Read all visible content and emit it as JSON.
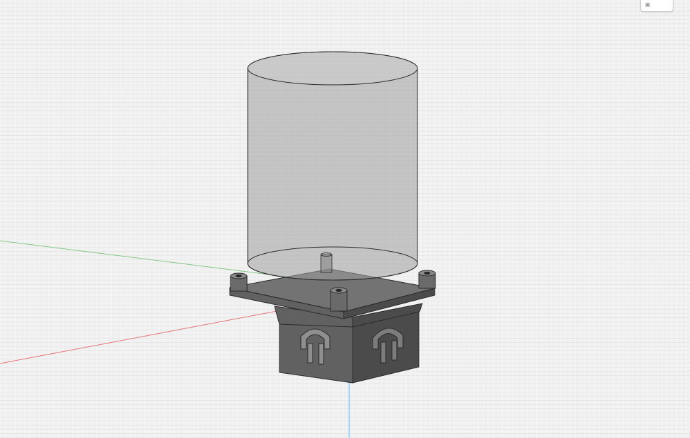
{
  "viewport": {
    "background_color": "#f1f1f1",
    "view_mode": "perspective-3d"
  },
  "axes": {
    "x_axis_color": "#e57373",
    "y_axis_color": "#81c784",
    "z_axis_color": "#64b5f6"
  },
  "model": {
    "cylinder_color": "#9e9e9e",
    "cylinder_opacity": 0.55,
    "base_color": "#5c5c5c",
    "edge_color": "#2a2a2a"
  },
  "viewcube": {
    "icon": "viewcube-icon"
  }
}
